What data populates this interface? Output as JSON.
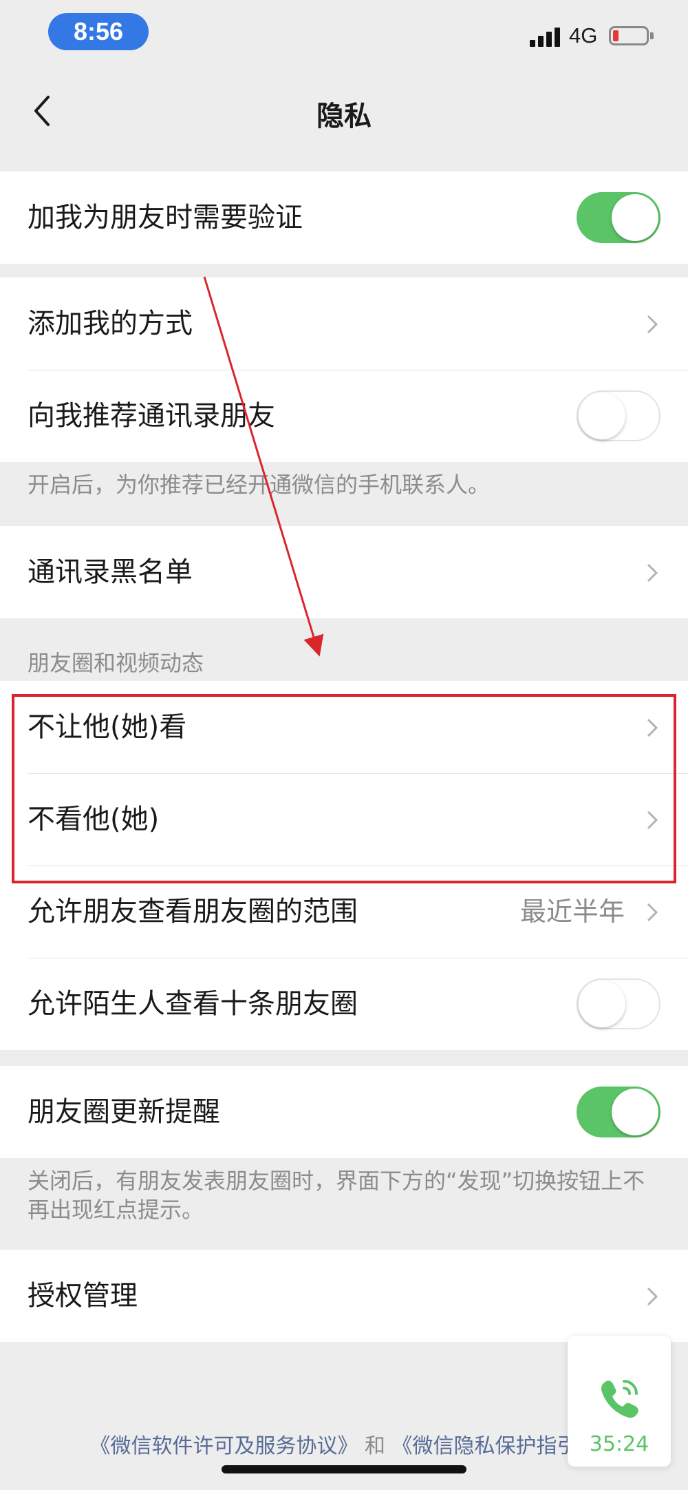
{
  "status_bar": {
    "time": "8:56",
    "network": "4G"
  },
  "nav": {
    "title": "隐私"
  },
  "groups": {
    "verify": {
      "label": "加我为朋友时需要验证"
    },
    "add_methods": {
      "add_way_label": "添加我的方式",
      "recommend_label": "向我推荐通讯录朋友",
      "note": "开启后，为你推荐已经开通微信的手机联系人。"
    },
    "blacklist": {
      "label": "通讯录黑名单"
    },
    "moments": {
      "header": "朋友圈和视频动态",
      "hide_from_label": "不让他(她)看",
      "dont_see_label": "不看他(她)",
      "range_label": "允许朋友查看朋友圈的范围",
      "range_value": "最近半年",
      "strangers_label": "允许陌生人查看十条朋友圈"
    },
    "updates": {
      "label": "朋友圈更新提醒",
      "note": "关闭后，有朋友发表朋友圈时，界面下方的“发现”切换按钮上不再出现红点提示。"
    },
    "auth": {
      "label": "授权管理"
    }
  },
  "footer": {
    "license_link": "《微信软件许可及服务协议》",
    "and": "和",
    "privacy_link": "《微信隐私保护指引》"
  },
  "call_widget": {
    "time": "35:24"
  },
  "toggles": {
    "verify": true,
    "recommend": false,
    "strangers": false,
    "updates": true
  },
  "colors": {
    "accent_green": "#5ac467",
    "link_blue": "#576b95",
    "annotation_red": "#d9262c",
    "time_pill_blue": "#3478e6"
  }
}
